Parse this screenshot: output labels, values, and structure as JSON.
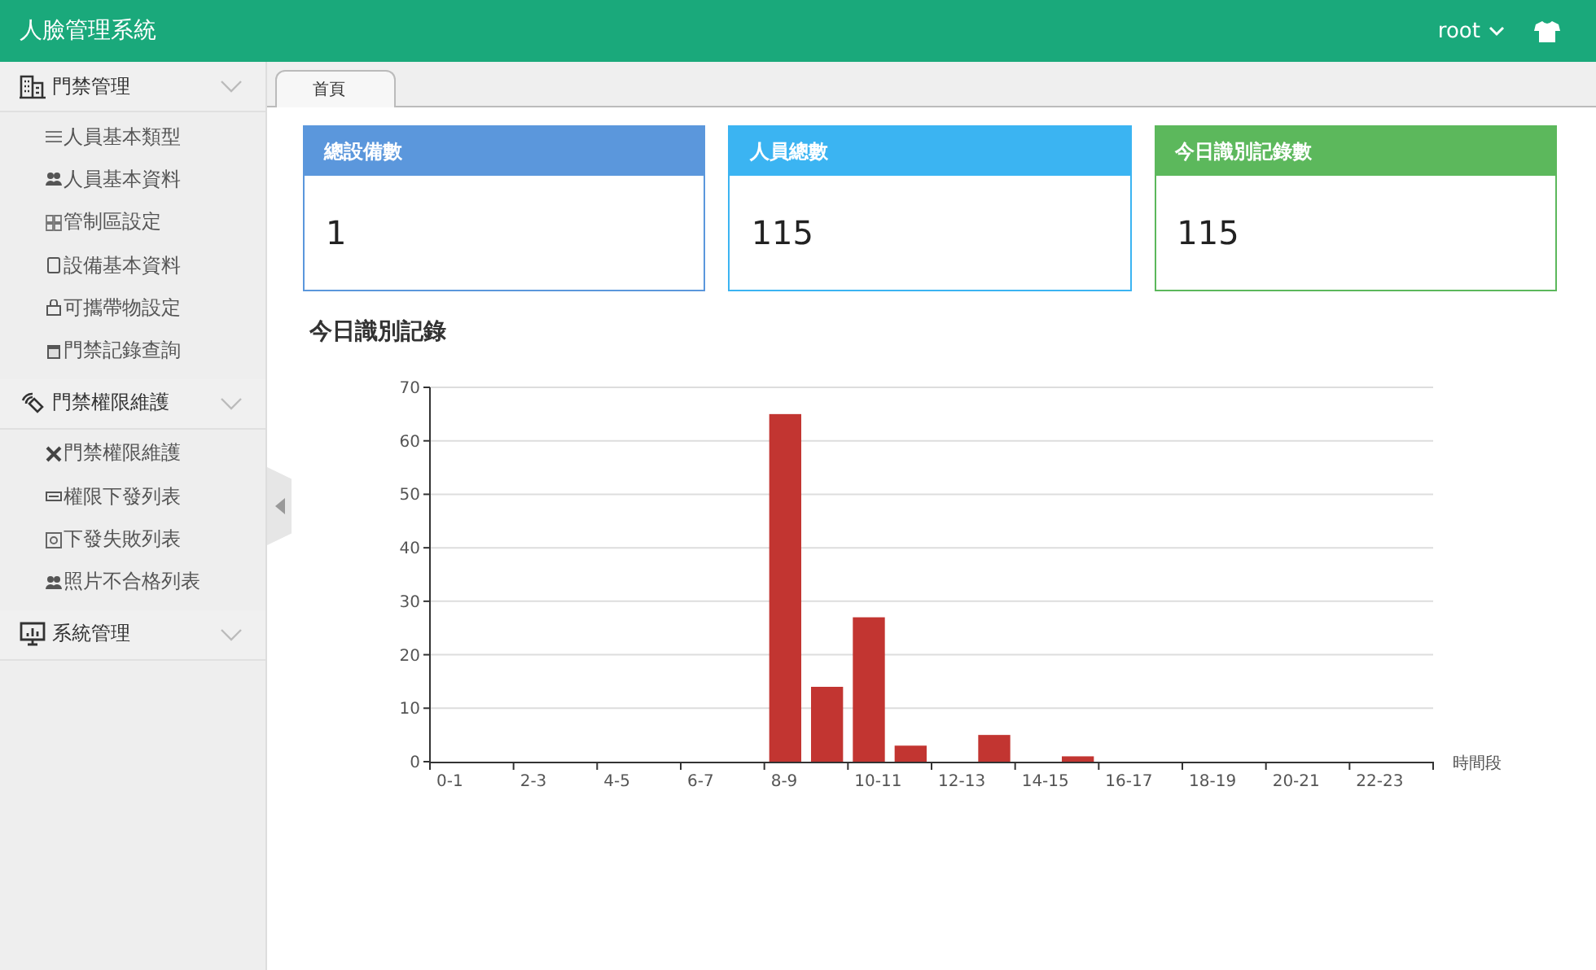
{
  "header": {
    "title": "人臉管理系統",
    "user": "root"
  },
  "sidebar": [
    {
      "label": "門禁管理",
      "children": [
        {
          "label": "人員基本類型"
        },
        {
          "label": "人員基本資料"
        },
        {
          "label": "管制區設定"
        },
        {
          "label": "設備基本資料"
        },
        {
          "label": "可攜帶物設定"
        },
        {
          "label": "門禁記錄查詢"
        }
      ]
    },
    {
      "label": "門禁權限維護",
      "children": [
        {
          "label": "門禁權限維護"
        },
        {
          "label": "權限下發列表"
        },
        {
          "label": "下發失敗列表"
        },
        {
          "label": "照片不合格列表"
        }
      ]
    },
    {
      "label": "系統管理"
    }
  ],
  "tabs": [
    {
      "label": "首頁",
      "selected": true
    }
  ],
  "cards": [
    {
      "title": "總設備數",
      "value": "1",
      "color": "#5b97dc"
    },
    {
      "title": "人員總數",
      "value": "115",
      "color": "#3bb4f2"
    },
    {
      "title": "今日識別記錄數",
      "value": "115",
      "color": "#5cb85c"
    }
  ],
  "chart_title": "今日識別記錄",
  "chart_data": {
    "type": "bar",
    "xlabel": "時間段",
    "categories": [
      "0-1",
      null,
      "2-3",
      null,
      "4-5",
      null,
      "6-7",
      null,
      "8-9",
      null,
      "10-11",
      null,
      "12-13",
      null,
      "14-15",
      null,
      "16-17",
      null,
      "18-19",
      null,
      "20-21",
      null,
      "22-23",
      null
    ],
    "values": [
      0,
      0,
      0,
      0,
      0,
      0,
      0,
      0,
      65,
      14,
      27,
      3,
      0,
      5,
      0,
      1,
      0,
      0,
      0,
      0,
      0,
      0,
      0,
      0
    ],
    "ylim": [
      0,
      70
    ],
    "grid": true,
    "yticks": [
      0,
      10,
      20,
      30,
      40,
      50,
      60,
      70
    ]
  }
}
